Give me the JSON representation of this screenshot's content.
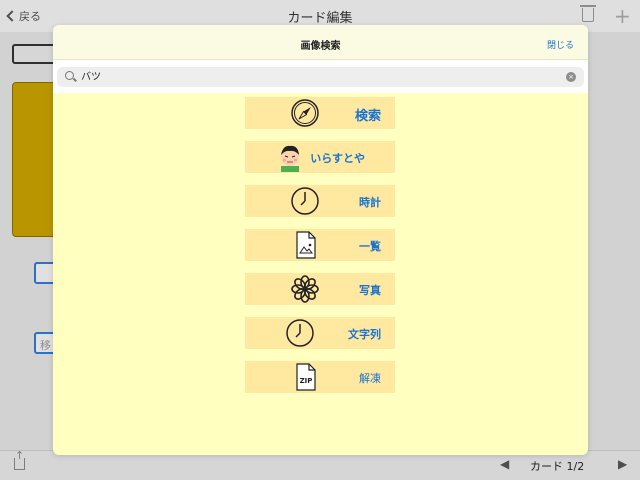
{
  "app": {
    "back_label": "戻る",
    "title": "カード編集",
    "bg_field2_text": "移"
  },
  "bottom": {
    "prev_symbol": "◀",
    "page_label": "カード",
    "page_value": "1/2",
    "next_symbol": "▶"
  },
  "modal": {
    "title": "画像検索",
    "close_label": "閉じる",
    "search": {
      "value": "バツ",
      "clear_symbol": "×"
    },
    "results": [
      {
        "label": "検索",
        "icon": "compass-icon"
      },
      {
        "label": "いらすとや",
        "icon": "boy-face-icon"
      },
      {
        "label": "時計",
        "icon": "clock-icon"
      },
      {
        "label": "一覧",
        "icon": "image-file-icon"
      },
      {
        "label": "写真",
        "icon": "photos-flower-icon"
      },
      {
        "label": "文字列",
        "icon": "clock-icon"
      },
      {
        "label": "解凍",
        "icon": "zip-file-icon"
      }
    ],
    "colors": {
      "panel": "#ffffc0",
      "item": "#ffe9a0",
      "link": "#1a73d1"
    }
  }
}
